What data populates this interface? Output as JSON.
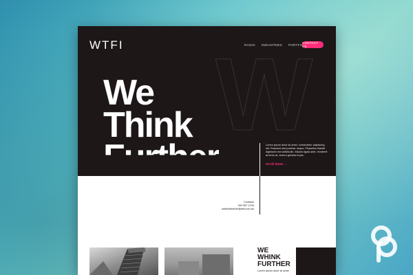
{
  "site": {
    "logo": "WTFI",
    "nav": [
      "RADIO",
      "INDUSTRIES",
      "PORTFOLIO"
    ],
    "contact_button": "CONTACT US",
    "bg_letters": "W",
    "headline": {
      "line1": "We",
      "line2": "Think",
      "line3": "Further"
    },
    "intro_text": "Lorem ipsum dolor sit amet, consectetur adipiscing elit. Praesent sed pulvinar neque. Phasellus blandit dignissim est sollicitudin. Mauris ligula ante, hendrerit at tortor at, viverra gravida turpis.",
    "scroll_label": "Scroll down →",
    "contacts": {
      "label": "Contacts",
      "phone": "000 987 1234",
      "email": "wethinkfurther@wtfi.com.au"
    },
    "promo": {
      "line1": "WE",
      "line2": "WHINK",
      "line3": "FURTHER",
      "text": "Lorem ipsum dolor sit amet"
    },
    "colors": {
      "dark": "#1d1718",
      "accent": "#ff2e7a",
      "light": "#ffffff"
    }
  },
  "watermark": {
    "icon": "cp-logo-icon"
  }
}
